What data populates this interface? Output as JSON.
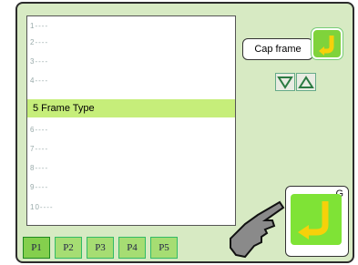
{
  "list": {
    "rows": [
      "1----",
      "2----",
      "3----",
      "4----"
    ],
    "selected": "5 Frame Type",
    "rows_after": [
      "6----",
      "7----",
      "8----",
      "9----",
      "10----"
    ]
  },
  "buttons": {
    "cap_frame": "Cap frame",
    "g_label": "G"
  },
  "tabs": [
    "P1",
    "P2",
    "P3",
    "P4",
    "P5"
  ],
  "pointer_text": "•",
  "colors": {
    "panel_bg": "#d7eac3",
    "selection": "#c6ee7a",
    "accent_green": "#7fe336",
    "arrow_yellow": "#f6d10a"
  },
  "icons": {
    "back_top": "return-arrow-icon",
    "down": "chevron-down-icon",
    "up": "chevron-up-icon",
    "g_button": "return-arrow-icon",
    "hand": "hand-pointer-icon"
  }
}
